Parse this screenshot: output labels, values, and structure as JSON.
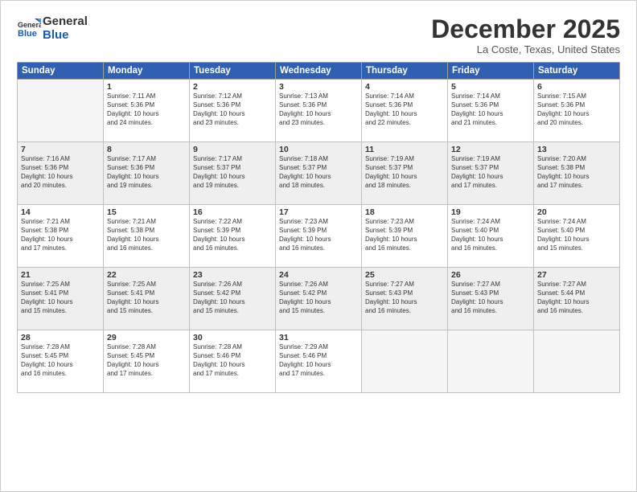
{
  "logo": {
    "line1": "General",
    "line2": "Blue"
  },
  "title": "December 2025",
  "subtitle": "La Coste, Texas, United States",
  "days_of_week": [
    "Sunday",
    "Monday",
    "Tuesday",
    "Wednesday",
    "Thursday",
    "Friday",
    "Saturday"
  ],
  "weeks": [
    [
      {
        "day": "",
        "detail": ""
      },
      {
        "day": "1",
        "detail": "Sunrise: 7:11 AM\nSunset: 5:36 PM\nDaylight: 10 hours\nand 24 minutes."
      },
      {
        "day": "2",
        "detail": "Sunrise: 7:12 AM\nSunset: 5:36 PM\nDaylight: 10 hours\nand 23 minutes."
      },
      {
        "day": "3",
        "detail": "Sunrise: 7:13 AM\nSunset: 5:36 PM\nDaylight: 10 hours\nand 23 minutes."
      },
      {
        "day": "4",
        "detail": "Sunrise: 7:14 AM\nSunset: 5:36 PM\nDaylight: 10 hours\nand 22 minutes."
      },
      {
        "day": "5",
        "detail": "Sunrise: 7:14 AM\nSunset: 5:36 PM\nDaylight: 10 hours\nand 21 minutes."
      },
      {
        "day": "6",
        "detail": "Sunrise: 7:15 AM\nSunset: 5:36 PM\nDaylight: 10 hours\nand 20 minutes."
      }
    ],
    [
      {
        "day": "7",
        "detail": "Sunrise: 7:16 AM\nSunset: 5:36 PM\nDaylight: 10 hours\nand 20 minutes."
      },
      {
        "day": "8",
        "detail": "Sunrise: 7:17 AM\nSunset: 5:36 PM\nDaylight: 10 hours\nand 19 minutes."
      },
      {
        "day": "9",
        "detail": "Sunrise: 7:17 AM\nSunset: 5:37 PM\nDaylight: 10 hours\nand 19 minutes."
      },
      {
        "day": "10",
        "detail": "Sunrise: 7:18 AM\nSunset: 5:37 PM\nDaylight: 10 hours\nand 18 minutes."
      },
      {
        "day": "11",
        "detail": "Sunrise: 7:19 AM\nSunset: 5:37 PM\nDaylight: 10 hours\nand 18 minutes."
      },
      {
        "day": "12",
        "detail": "Sunrise: 7:19 AM\nSunset: 5:37 PM\nDaylight: 10 hours\nand 17 minutes."
      },
      {
        "day": "13",
        "detail": "Sunrise: 7:20 AM\nSunset: 5:38 PM\nDaylight: 10 hours\nand 17 minutes."
      }
    ],
    [
      {
        "day": "14",
        "detail": "Sunrise: 7:21 AM\nSunset: 5:38 PM\nDaylight: 10 hours\nand 17 minutes."
      },
      {
        "day": "15",
        "detail": "Sunrise: 7:21 AM\nSunset: 5:38 PM\nDaylight: 10 hours\nand 16 minutes."
      },
      {
        "day": "16",
        "detail": "Sunrise: 7:22 AM\nSunset: 5:39 PM\nDaylight: 10 hours\nand 16 minutes."
      },
      {
        "day": "17",
        "detail": "Sunrise: 7:23 AM\nSunset: 5:39 PM\nDaylight: 10 hours\nand 16 minutes."
      },
      {
        "day": "18",
        "detail": "Sunrise: 7:23 AM\nSunset: 5:39 PM\nDaylight: 10 hours\nand 16 minutes."
      },
      {
        "day": "19",
        "detail": "Sunrise: 7:24 AM\nSunset: 5:40 PM\nDaylight: 10 hours\nand 16 minutes."
      },
      {
        "day": "20",
        "detail": "Sunrise: 7:24 AM\nSunset: 5:40 PM\nDaylight: 10 hours\nand 15 minutes."
      }
    ],
    [
      {
        "day": "21",
        "detail": "Sunrise: 7:25 AM\nSunset: 5:41 PM\nDaylight: 10 hours\nand 15 minutes."
      },
      {
        "day": "22",
        "detail": "Sunrise: 7:25 AM\nSunset: 5:41 PM\nDaylight: 10 hours\nand 15 minutes."
      },
      {
        "day": "23",
        "detail": "Sunrise: 7:26 AM\nSunset: 5:42 PM\nDaylight: 10 hours\nand 15 minutes."
      },
      {
        "day": "24",
        "detail": "Sunrise: 7:26 AM\nSunset: 5:42 PM\nDaylight: 10 hours\nand 15 minutes."
      },
      {
        "day": "25",
        "detail": "Sunrise: 7:27 AM\nSunset: 5:43 PM\nDaylight: 10 hours\nand 16 minutes."
      },
      {
        "day": "26",
        "detail": "Sunrise: 7:27 AM\nSunset: 5:43 PM\nDaylight: 10 hours\nand 16 minutes."
      },
      {
        "day": "27",
        "detail": "Sunrise: 7:27 AM\nSunset: 5:44 PM\nDaylight: 10 hours\nand 16 minutes."
      }
    ],
    [
      {
        "day": "28",
        "detail": "Sunrise: 7:28 AM\nSunset: 5:45 PM\nDaylight: 10 hours\nand 16 minutes."
      },
      {
        "day": "29",
        "detail": "Sunrise: 7:28 AM\nSunset: 5:45 PM\nDaylight: 10 hours\nand 17 minutes."
      },
      {
        "day": "30",
        "detail": "Sunrise: 7:28 AM\nSunset: 5:46 PM\nDaylight: 10 hours\nand 17 minutes."
      },
      {
        "day": "31",
        "detail": "Sunrise: 7:29 AM\nSunset: 5:46 PM\nDaylight: 10 hours\nand 17 minutes."
      },
      {
        "day": "",
        "detail": ""
      },
      {
        "day": "",
        "detail": ""
      },
      {
        "day": "",
        "detail": ""
      }
    ]
  ]
}
